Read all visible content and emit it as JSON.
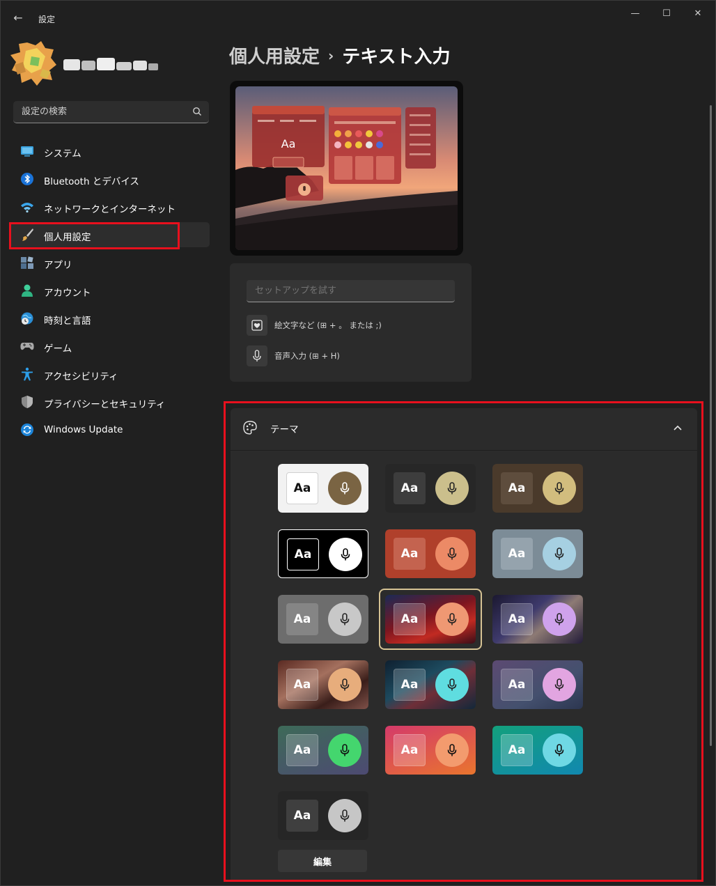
{
  "window": {
    "app_title": "設定",
    "back_label": "←",
    "minimize_label": "—",
    "maximize_label": "☐",
    "close_label": "✕"
  },
  "search": {
    "placeholder": "設定の検索"
  },
  "sidebar": {
    "items": [
      {
        "name": "system",
        "label": "システム",
        "icon": "system-icon"
      },
      {
        "name": "bluetooth",
        "label": "Bluetooth とデバイス",
        "icon": "bluetooth-icon"
      },
      {
        "name": "network",
        "label": "ネットワークとインターネット",
        "icon": "wifi-icon"
      },
      {
        "name": "personalization",
        "label": "個人用設定",
        "icon": "brush-icon",
        "active": true
      },
      {
        "name": "apps",
        "label": "アプリ",
        "icon": "apps-icon"
      },
      {
        "name": "accounts",
        "label": "アカウント",
        "icon": "person-icon"
      },
      {
        "name": "time-language",
        "label": "時刻と言語",
        "icon": "globe-clock-icon"
      },
      {
        "name": "gaming",
        "label": "ゲーム",
        "icon": "gamepad-icon"
      },
      {
        "name": "accessibility",
        "label": "アクセシビリティ",
        "icon": "accessibility-icon"
      },
      {
        "name": "privacy",
        "label": "プライバシーとセキュリティ",
        "icon": "shield-icon"
      },
      {
        "name": "windows-update",
        "label": "Windows Update",
        "icon": "update-icon"
      }
    ]
  },
  "breadcrumb": {
    "parent": "個人用設定",
    "separator": "›",
    "current": "テキスト入力"
  },
  "preview": {
    "sample_text": "Aa"
  },
  "typing": {
    "tryout_placeholder": "セットアップを試す",
    "emoji_shortcut": "絵文字など (⊞ + 。 または ;)",
    "voice_shortcut": "音声入力 (⊞ + H)"
  },
  "theme": {
    "title": "テーマ",
    "sample_text": "Aa",
    "edit_label": "編集",
    "tiles": [
      {
        "name": "light",
        "bg": "#f2f2f2",
        "aa_bg": "#ffffff",
        "aa_fg": "#111111",
        "aa_border": "#d0d0d0",
        "mic_bg": "#7a6443",
        "mic_fg": "#ffffff"
      },
      {
        "name": "dark-gold",
        "bg": "#272727",
        "aa_bg": "#3d3d3d",
        "aa_fg": "#ffffff",
        "aa_border": "#3d3d3d",
        "mic_bg": "#cbbf8c",
        "mic_fg": "#222222"
      },
      {
        "name": "brown",
        "bg": "#4a3a2b",
        "aa_bg": "#5e4d3d",
        "aa_fg": "#ffffff",
        "aa_border": "#5e4d3d",
        "mic_bg": "#d2bd7e",
        "mic_fg": "#222222"
      },
      {
        "name": "high-contrast",
        "bg": "#000000",
        "aa_bg": "#000000",
        "aa_fg": "#ffffff",
        "aa_border": "#ffffff",
        "mic_bg": "#ffffff",
        "mic_fg": "#000000",
        "outline": "#ffffff"
      },
      {
        "name": "rust",
        "bg": "#b0402b",
        "aa_bg": "#c4634f",
        "aa_fg": "#ffffff",
        "aa_border": "#c4634f",
        "mic_bg": "#ec8a66",
        "mic_fg": "#222222"
      },
      {
        "name": "slate",
        "bg": "#7c8c97",
        "aa_bg": "#95a3ad",
        "aa_fg": "#ffffff",
        "aa_border": "#95a3ad",
        "mic_bg": "#a6d0e2",
        "mic_fg": "#222222"
      },
      {
        "name": "gray",
        "bg": "#6d6d6d",
        "aa_bg": "#858585",
        "aa_fg": "#ffffff",
        "aa_border": "#858585",
        "mic_bg": "#c8c8c8",
        "mic_fg": "#222222"
      },
      {
        "name": "red-wave",
        "bg": "linear-gradient(160deg,#1b2a55 0%,#7d1620 45%,#c12a22 70%,#3a0e18 100%)",
        "aa_bg": "rgba(255,255,255,0.22)",
        "aa_fg": "#ffffff",
        "aa_border": "rgba(255,255,255,0.22)",
        "mic_bg": "#ef9873",
        "mic_fg": "#222222",
        "selected": true
      },
      {
        "name": "purple-wave",
        "bg": "linear-gradient(140deg,#1b1830 0%,#3e3a6c 40%,#8d7a74 60%,#241d3a 100%)",
        "aa_bg": "rgba(255,255,255,0.2)",
        "aa_fg": "#ffffff",
        "aa_border": "rgba(255,255,255,0.2)",
        "mic_bg": "#cfa2ec",
        "mic_fg": "#222222"
      },
      {
        "name": "copper-wave",
        "bg": "linear-gradient(150deg,#5a2a22 0%,#a4705e 40%,#3a1e1a 70%,#7e5048 100%)",
        "aa_bg": "rgba(255,255,255,0.2)",
        "aa_fg": "#ffffff",
        "aa_border": "rgba(255,255,255,0.2)",
        "mic_bg": "#e7ad7c",
        "mic_fg": "#222222"
      },
      {
        "name": "teal-wave",
        "bg": "linear-gradient(150deg,#0f2030 0%,#1d4a5e 40%,#6e2e38 60%,#12283a 100%)",
        "aa_bg": "rgba(255,255,255,0.2)",
        "aa_fg": "#ffffff",
        "aa_border": "rgba(255,255,255,0.2)",
        "mic_bg": "#5fdde0",
        "mic_fg": "#222222"
      },
      {
        "name": "dusk-wave",
        "bg": "linear-gradient(150deg,#5c4a72 0%,#44506e 60%,#2c3650 100%)",
        "aa_bg": "rgba(255,255,255,0.18)",
        "aa_fg": "#ffffff",
        "aa_border": "rgba(255,255,255,0.18)",
        "mic_bg": "#e2a5e1",
        "mic_fg": "#222222"
      },
      {
        "name": "green-dusk",
        "bg": "linear-gradient(160deg,#3d6a58 0%,#4d4a72 100%)",
        "aa_bg": "rgba(255,255,255,0.2)",
        "aa_fg": "#ffffff",
        "aa_border": "rgba(255,255,255,0.2)",
        "mic_bg": "#44d66e",
        "mic_fg": "#111111"
      },
      {
        "name": "sunset",
        "bg": "linear-gradient(160deg,#d43a6a 0%,#e9752e 100%)",
        "aa_bg": "rgba(255,255,255,0.22)",
        "aa_fg": "#ffffff",
        "aa_border": "rgba(255,255,255,0.22)",
        "mic_bg": "#f39b6e",
        "mic_fg": "#111111"
      },
      {
        "name": "ocean",
        "bg": "linear-gradient(160deg,#13a07c 0%,#1188b0 100%)",
        "aa_bg": "rgba(255,255,255,0.22)",
        "aa_fg": "#ffffff",
        "aa_border": "rgba(255,255,255,0.22)",
        "mic_bg": "#6fd8e4",
        "mic_fg": "#111111"
      },
      {
        "name": "charcoal",
        "bg": "#262626",
        "aa_bg": "#3f3f3f",
        "aa_fg": "#ffffff",
        "aa_border": "#3f3f3f",
        "mic_bg": "#c6c6c6",
        "mic_fg": "#222222"
      }
    ]
  }
}
